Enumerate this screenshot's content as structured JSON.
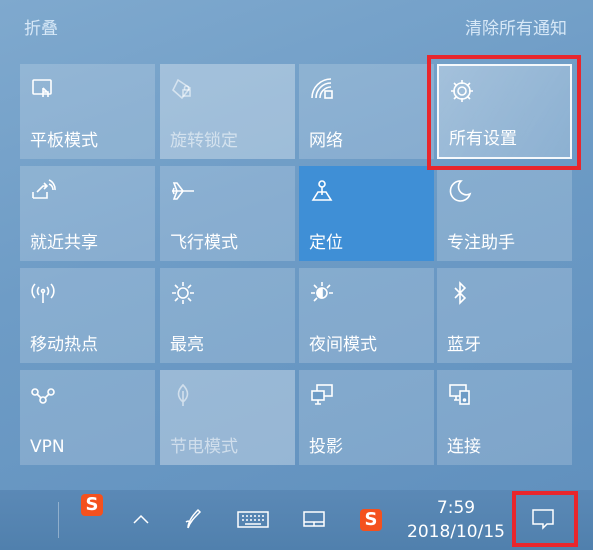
{
  "header": {
    "collapse_label": "折叠",
    "clear_label": "清除所有通知"
  },
  "tiles": [
    {
      "label": "平板模式",
      "icon": "tablet-mode-icon",
      "state": "normal"
    },
    {
      "label": "旋转锁定",
      "icon": "rotation-lock-icon",
      "state": "disabled"
    },
    {
      "label": "网络",
      "icon": "network-icon",
      "state": "normal"
    },
    {
      "label": "所有设置",
      "icon": "gear-icon",
      "state": "highlight"
    },
    {
      "label": "就近共享",
      "icon": "nearby-share-icon",
      "state": "normal"
    },
    {
      "label": "飞行模式",
      "icon": "airplane-icon",
      "state": "normal"
    },
    {
      "label": "定位",
      "icon": "location-icon",
      "state": "active"
    },
    {
      "label": "专注助手",
      "icon": "moon-icon",
      "state": "normal"
    },
    {
      "label": "移动热点",
      "icon": "hotspot-icon",
      "state": "normal"
    },
    {
      "label": "最亮",
      "icon": "brightness-icon",
      "state": "normal"
    },
    {
      "label": "夜间模式",
      "icon": "night-light-icon",
      "state": "normal"
    },
    {
      "label": "蓝牙",
      "icon": "bluetooth-icon",
      "state": "normal"
    },
    {
      "label": "VPN",
      "icon": "vpn-icon",
      "state": "normal"
    },
    {
      "label": "节电模式",
      "icon": "battery-saver-icon",
      "state": "disabled"
    },
    {
      "label": "投影",
      "icon": "project-icon",
      "state": "normal"
    },
    {
      "label": "连接",
      "icon": "connect-icon",
      "state": "normal"
    }
  ],
  "taskbar": {
    "time": "7:59",
    "date": "2018/10/15",
    "sogou_glyph": "S",
    "icons": [
      "chevron-up-icon",
      "pen-icon",
      "keyboard-icon",
      "touchpad-icon",
      "sogou-ime-icon",
      "action-center-icon"
    ]
  },
  "colors": {
    "accent": "#3f8fd6",
    "highlight_box": "#e8262d"
  }
}
